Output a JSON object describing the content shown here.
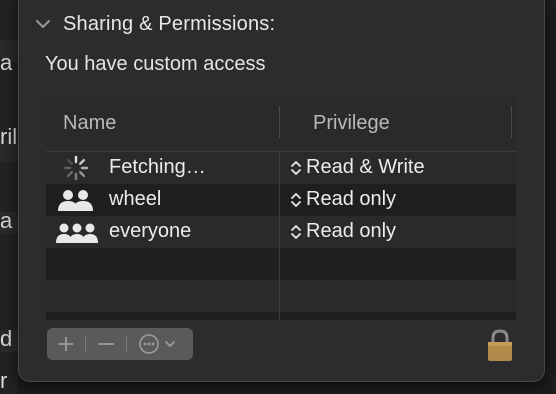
{
  "background": {
    "fragments": [
      "a",
      "ril",
      "a",
      "d",
      "r"
    ]
  },
  "panel": {
    "section_title": "Sharing & Permissions:",
    "subtitle": "You have custom access"
  },
  "table": {
    "columns": [
      "Name",
      "Privilege"
    ],
    "rows": [
      {
        "name": "Fetching…",
        "privilege": "Read & Write",
        "icon": "loading-spinner-icon"
      },
      {
        "name": "wheel",
        "privilege": "Read only",
        "icon": "group-icon"
      },
      {
        "name": "everyone",
        "privilege": "Read only",
        "icon": "everyone-icon"
      }
    ]
  },
  "controls": {
    "add_icon": "plus-icon",
    "remove_icon": "minus-icon",
    "action_icon": "ellipsis-circle-icon",
    "lock_icon": "lock-icon"
  },
  "colors": {
    "panel_bg": "#2c2c2e",
    "lock": "#b08a4a"
  }
}
